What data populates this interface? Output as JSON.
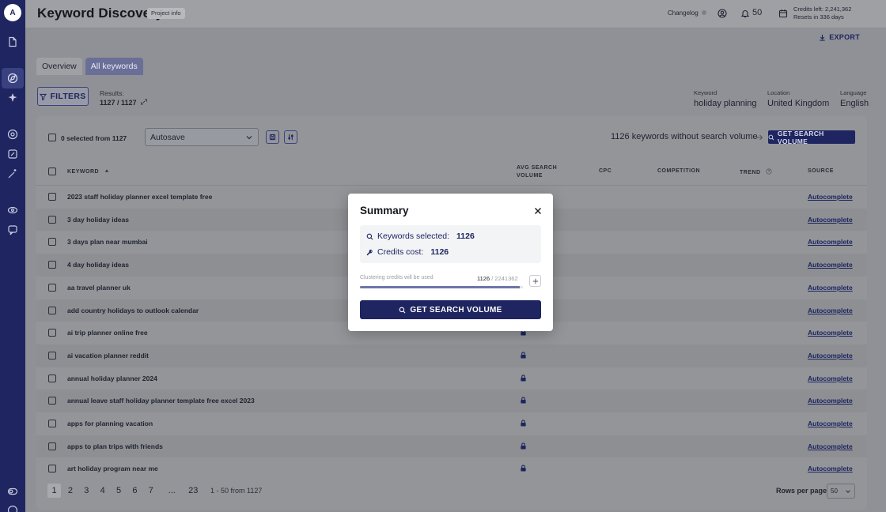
{
  "sidebar": {
    "logo_text": "A"
  },
  "header": {
    "title": "Keyword Discovery",
    "project_info": "Project info",
    "changelog": "Changelog",
    "credits_count": "50",
    "credits_left": "Credits left: 2,241,362",
    "resets": "Resets in 336 days"
  },
  "export_label": "EXPORT",
  "tabs": [
    {
      "label": "Overview",
      "active": false
    },
    {
      "label": "All keywords",
      "active": true
    }
  ],
  "filters_label": "FILTERS",
  "results": {
    "label": "Results:",
    "value": "1127 / 1127"
  },
  "meta": {
    "keyword_label": "Keyword",
    "keyword_value": "holiday planning",
    "location_label": "Location",
    "location_value": "United Kingdom",
    "language_label": "Language",
    "language_value": "English"
  },
  "toolbar": {
    "selected_text": "0 selected from 1127",
    "autosave": "Autosave",
    "no_volume_text": "1126 keywords without search volume",
    "get_volume": "GET SEARCH VOLUME"
  },
  "table": {
    "headers": {
      "keyword": "KEYWORD",
      "avg_1": "AVG SEARCH",
      "avg_2": "VOLUME",
      "cpc": "CPC",
      "competition": "COMPETITION",
      "trend": "TREND",
      "source": "SOURCE"
    },
    "rows": [
      {
        "keyword": "2023 staff holiday planner excel template free",
        "source": "Autocomplete"
      },
      {
        "keyword": "3 day holiday ideas",
        "source": "Autocomplete"
      },
      {
        "keyword": "3 days plan near mumbai",
        "source": "Autocomplete"
      },
      {
        "keyword": "4 day holiday ideas",
        "source": "Autocomplete"
      },
      {
        "keyword": "aa travel planner uk",
        "source": "Autocomplete"
      },
      {
        "keyword": "add country holidays to outlook calendar",
        "source": "Autocomplete"
      },
      {
        "keyword": "ai trip planner online free",
        "source": "Autocomplete"
      },
      {
        "keyword": "ai vacation planner reddit",
        "source": "Autocomplete"
      },
      {
        "keyword": "annual holiday planner 2024",
        "source": "Autocomplete"
      },
      {
        "keyword": "annual leave staff holiday planner template free excel 2023",
        "source": "Autocomplete"
      },
      {
        "keyword": "apps for planning vacation",
        "source": "Autocomplete"
      },
      {
        "keyword": "apps to plan trips with friends",
        "source": "Autocomplete"
      },
      {
        "keyword": "art holiday program near me",
        "source": "Autocomplete"
      }
    ]
  },
  "pagination": {
    "pages": [
      "1",
      "2",
      "3",
      "4",
      "5",
      "6",
      "7",
      "...",
      "23"
    ],
    "active": "1",
    "range": "1 - 50 from 1127",
    "rows_label": "Rows per page",
    "rows_value": "50"
  },
  "modal": {
    "title": "Summary",
    "keywords_label": "Keywords selected:",
    "keywords_value": "1126",
    "credits_label": "Credits cost:",
    "credits_value": "1126",
    "clustering_label": "Clustering credits will be used",
    "clustering_used": "1126",
    "clustering_sep": "/",
    "clustering_total": "2241362",
    "progress_fraction": 0.98,
    "button_label": "GET SEARCH VOLUME"
  }
}
